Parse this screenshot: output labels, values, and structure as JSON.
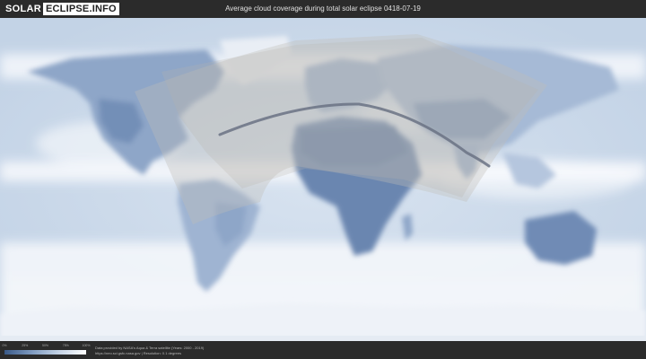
{
  "header": {
    "logo_part1": "SOLAR",
    "logo_part2": "ECLIPSE.INFO",
    "title": "Average cloud coverage during total solar eclipse 0418-07-19"
  },
  "legend": {
    "ticks": [
      "0%",
      "25%",
      "50%",
      "75%",
      "100%"
    ],
    "colors": [
      "#3a5a88",
      "#7e9ac0",
      "#c4d3e6",
      "#ffffff"
    ]
  },
  "credits": {
    "line1": "Data provided by NASA's Aqua & Terra satellite (Years: 2000 - 2019)",
    "line2": "https://neo.sci.gsfc.nasa.gov | Resolution: 0.1 degrees"
  },
  "colors": {
    "background": "#2a2a2a",
    "map_base": "#e8eef6",
    "cloud_light": "#ffffff",
    "land_dark": "#6a86b0",
    "eclipse_path": "#6a7284",
    "visibility_region": "#bfbcb6"
  }
}
